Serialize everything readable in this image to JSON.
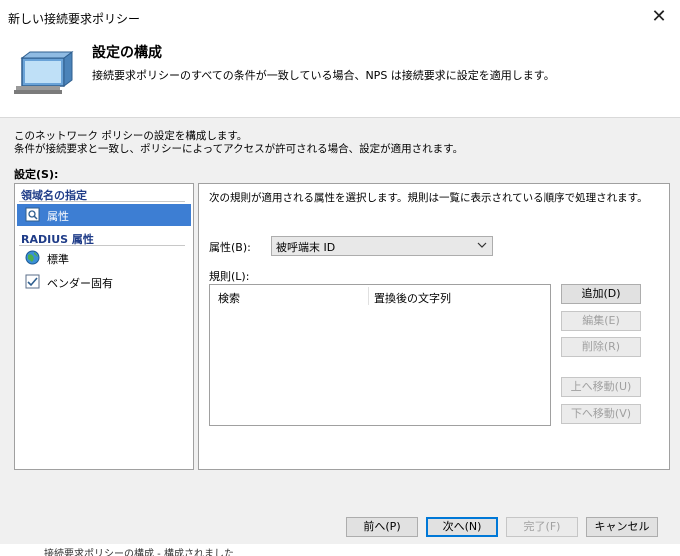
{
  "window": {
    "title": "新しい接続要求ポリシー",
    "close_glyph": "✕"
  },
  "header": {
    "title": "設定の構成",
    "subtitle": "接続要求ポリシーのすべての条件が一致している場合、NPS は接続要求に設定を適用します。",
    "icon": "monitor-icon"
  },
  "intro": {
    "line1": "このネットワーク ポリシーの設定を構成します。",
    "line2": "条件が接続要求と一致し、ポリシーによってアクセスが許可される場合、設定が適用されます。"
  },
  "settings_label": "設定(S):",
  "nav": {
    "group1": "領域名の指定",
    "group1_items": [
      {
        "label": "属性",
        "icon": "attribute-icon",
        "selected": true
      }
    ],
    "group2": "RADIUS 属性",
    "group2_items": [
      {
        "label": "標準",
        "icon": "globe-icon",
        "selected": false
      },
      {
        "label": "ベンダー固有",
        "icon": "checklist-icon",
        "selected": false
      }
    ]
  },
  "detail": {
    "description": "次の規則が適用される属性を選択します。規則は一覧に表示されている順序で処理されます。",
    "attribute_label": "属性(B):",
    "attribute_value": "被呼端末 ID",
    "rules_label": "規則(L):",
    "columns": [
      "検索",
      "置換後の文字列"
    ],
    "buttons": {
      "add": "追加(D)",
      "edit": "編集(E)",
      "delete": "削除(R)",
      "move_up": "上へ移動(U)",
      "move_down": "下へ移動(V)"
    }
  },
  "footer": {
    "prev": "前へ(P)",
    "next": "次へ(N)",
    "finish": "完了(F)",
    "cancel": "キャンセル"
  },
  "bottom_cut_text": "接続要求ポリシーの構成 - 構成されました",
  "colors": {
    "accent": "#0078d7",
    "selection": "#3d7ed3",
    "group_header": "#1f3c88"
  }
}
